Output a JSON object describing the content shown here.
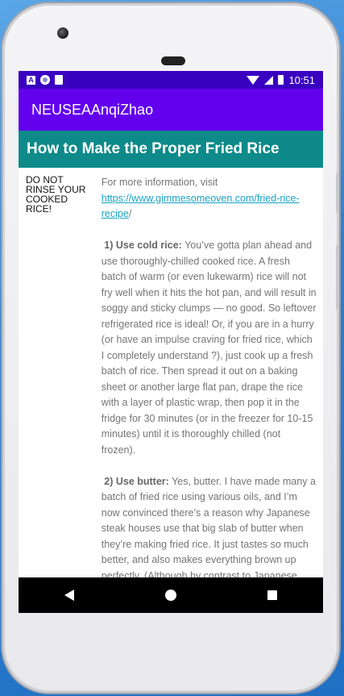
{
  "status_bar": {
    "time": "10:51",
    "left_icons": [
      "a-icon",
      "circle-icon",
      "sd-card-icon"
    ],
    "right_icons": [
      "wifi-icon",
      "signal-icon",
      "battery-icon"
    ]
  },
  "app_bar": {
    "title": "NEUSEAAnqiZhao"
  },
  "page": {
    "heading": "How to Make the Proper Fried Rice",
    "side_note": "DO NOT RINSE YOUR COOKED RICE!",
    "intro_prefix": "For more information, visit ",
    "link_text": "https://www.gimmesomeoven.com/fried-rice-recipe",
    "intro_suffix": "/",
    "step1_title": "1) Use cold rice:",
    "step1_body": " You’ve gotta plan ahead and use thoroughly-chilled cooked rice. A fresh batch of warm (or even lukewarm) rice will not fry well when it hits the hot pan, and will result in soggy and sticky clumps — no good. So leftover refrigerated rice is ideal! Or, if you are in a hurry (or have an impulse craving for fried rice, which I completely understand ?), just cook up a fresh batch of rice. Then spread it out on a baking sheet or another large flat pan, drape the rice with a layer of plastic wrap, then pop it in the fridge for 30 minutes (or in the freezer for 10-15 minutes) until it is thoroughly chilled (not frozen).",
    "step2_title": "2) Use butter:",
    "step2_body": " Yes, butter. I have made many a batch of fried rice using various oils, and I’m now convinced there’s a reason why Japanese steak houses use that big slab of butter when they’re making fried rice. It just tastes so much better, and also makes everything brown up perfectly. (Although by contrast to Japanese steak houses, we"
  },
  "colors": {
    "status_bar": "#3a00c0",
    "app_bar": "#6200ee",
    "title_band": "#0e8a8a",
    "link": "#1aa3c4"
  },
  "nav_bar": {
    "icons": [
      "back-icon",
      "home-icon",
      "recents-icon"
    ]
  }
}
